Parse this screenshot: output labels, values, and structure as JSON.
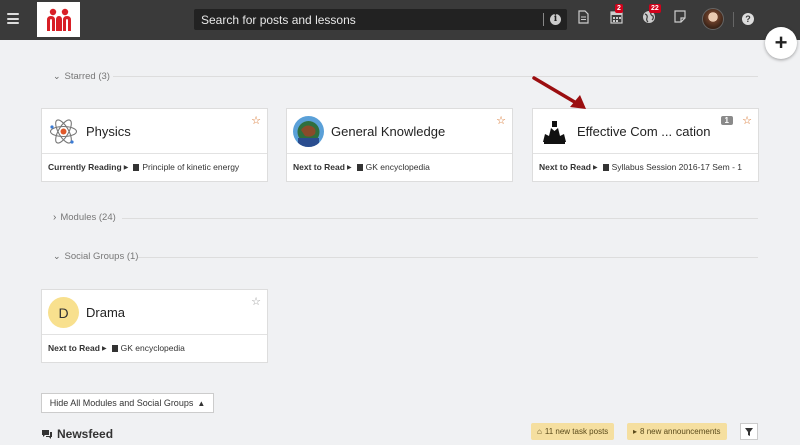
{
  "topbar": {
    "search_placeholder": "Search for posts and lessons",
    "calendar_badge": "2",
    "globe_badge": "22"
  },
  "sections": {
    "starred_label": "Starred (3)",
    "modules_label": "Modules (24)",
    "social_label": "Social Groups (1)"
  },
  "starred_cards": [
    {
      "title": "Physics",
      "foot_label": "Currently Reading",
      "foot_text": "Principle of kinetic energy"
    },
    {
      "title": "General Knowledge",
      "foot_label": "Next to Read",
      "foot_text": "GK encyclopedia"
    },
    {
      "title": "Effective Com ... cation",
      "badge": "1",
      "foot_label": "Next to Read",
      "foot_text": "Syllabus Session 2016-17 Sem - 1"
    }
  ],
  "social_cards": [
    {
      "initial": "D",
      "title": "Drama",
      "foot_label": "Next to Read",
      "foot_text": "GK encyclopedia"
    }
  ],
  "hide_button": "Hide All Modules and Social Groups",
  "newsfeed": {
    "title": "Newsfeed",
    "task_posts": "11 new task posts",
    "announcements": "8 new announcements"
  },
  "colors": {
    "topbar": "#3a3a3a",
    "accent_star": "#d4691e",
    "badge_red": "#d0021b",
    "pill_yellow": "#f5dfa0",
    "arrow": "#9b0e10"
  }
}
